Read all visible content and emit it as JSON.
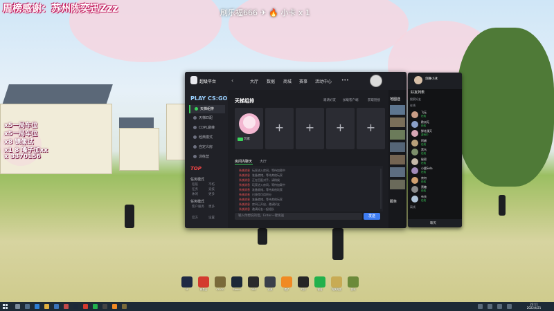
{
  "overlay": {
    "banner": "周榜感谢：苏州陈奕迅Zzz",
    "top_mark": "刷乐福666 ✈ 🔥 小卡 x 1",
    "side_items": [
      "x5一局车位",
      "x5一局车位",
      "x8 镜像试",
      "x1 8 嗓子加xx",
      "x 3370156"
    ]
  },
  "app": {
    "brand": "超级平台",
    "nav": {
      "back": "‹",
      "items": [
        "大厅",
        "数据",
        "商城",
        "赛事",
        "活动中心",
        "•••"
      ]
    },
    "left": {
      "play_title": "PLAY CS:GO",
      "menu": [
        "天梯组排",
        "天梯匹配",
        "CDPL巅峰",
        "经典模式",
        "自定义房",
        "训练营"
      ],
      "top_banner": "TOP",
      "section1": "任务模式",
      "section1_sub": [
        "巡航",
        "不朽",
        "任务",
        "竞技",
        "休闲",
        "更多"
      ],
      "section2": "任务模式",
      "section2_sub": [
        "客户服务",
        "更多"
      ],
      "footer": [
        "官方",
        "设置"
      ]
    },
    "room": {
      "title": "天梯组排",
      "options": [
        "邀请好友",
        "加载客户端",
        "获取链接"
      ],
      "user_name": "玩家"
    },
    "chat": {
      "tab_room": "房间内聊天",
      "tab_hall": "大厅",
      "messages": [
        {
          "who": "系统消息",
          "text": "玩家进入房间，等待加载中"
        },
        {
          "who": "系统消息",
          "text": "准备就绪，等待其他玩家"
        },
        {
          "who": "系统消息",
          "text": "正在匹配对手，请稍候"
        },
        {
          "who": "系统消息",
          "text": "玩家进入房间，等待加载中"
        },
        {
          "who": "系统消息",
          "text": "准备就绪，等待其他玩家"
        },
        {
          "who": "系统消息",
          "text": "已获得可用积分"
        },
        {
          "who": "系统消息",
          "text": "准备就绪，等待其他玩家"
        },
        {
          "who": "系统消息",
          "text": "房间已开启，邀请好友"
        },
        {
          "who": "系统消息",
          "text": "邀请好友一起组队"
        }
      ],
      "input_placeholder": "输入你想说的话，Enter一键发送",
      "send_label": "发送"
    },
    "right": {
      "map_label": "地图选",
      "service_label": "服务"
    }
  },
  "friends": {
    "self_name": "剑舞小冰",
    "title": "好友列表",
    "search_placeholder": "搜索好友",
    "group_online": "在线",
    "group_offline": "离线",
    "rows": [
      {
        "name": "飞无",
        "status": "在线"
      },
      {
        "name": "欧洲无",
        "status": "在线"
      },
      {
        "name": "鲜花漫天",
        "status": "游戏中"
      },
      {
        "name": "阿越",
        "status": "在线"
      },
      {
        "name": "黑鸟",
        "status": "在线"
      },
      {
        "name": "秘密",
        "status": "在线"
      },
      {
        "name": "小鹿Sela",
        "status": "在线"
      },
      {
        "name": "奈何",
        "status": "在线"
      },
      {
        "name": "黑糖",
        "status": "在线"
      },
      {
        "name": "布衣",
        "status": "在线"
      }
    ],
    "bottom_label": "聊天"
  },
  "dock": [
    {
      "name": "5E",
      "color": "#1f2a44"
    },
    {
      "name": "网易云",
      "color": "#d33b2f"
    },
    {
      "name": "CS:GO",
      "color": "#7a6a3a"
    },
    {
      "name": "Steam",
      "color": "#1b2838"
    },
    {
      "name": "OBS",
      "color": "#2b2b2b"
    },
    {
      "name": "完美",
      "color": "#3a3f4a"
    },
    {
      "name": "橘子",
      "color": "#f08a24"
    },
    {
      "name": "时钟",
      "color": "#262626"
    },
    {
      "name": "微信",
      "color": "#22b14c"
    },
    {
      "name": "完美竞技",
      "color": "#c8ab54"
    },
    {
      "name": "游戏",
      "color": "#6b8a3a"
    }
  ],
  "taskbar": {
    "time": "23:11",
    "date": "2022/4/21"
  }
}
